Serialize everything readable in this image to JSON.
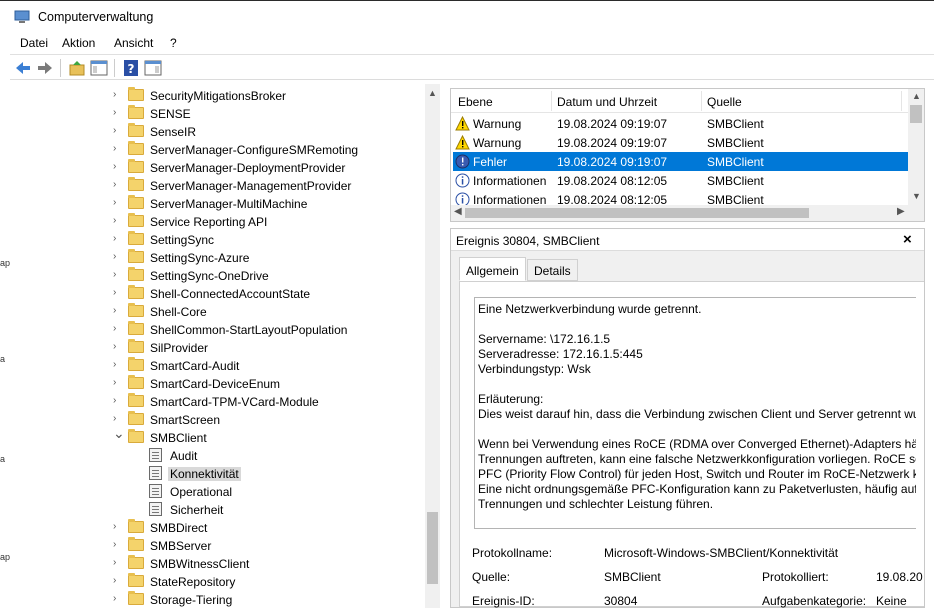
{
  "window": {
    "title": "Computerverwaltung"
  },
  "menu": {
    "items": [
      "Datei",
      "Aktion",
      "Ansicht",
      "?"
    ]
  },
  "left_edge_fragments": [
    "ap",
    "a",
    "a",
    "ap"
  ],
  "tree": {
    "items": [
      {
        "label": "SecurityMitigationsBroker",
        "type": "folder",
        "expanded": false
      },
      {
        "label": "SENSE",
        "type": "folder",
        "expanded": false
      },
      {
        "label": "SenseIR",
        "type": "folder",
        "expanded": false
      },
      {
        "label": "ServerManager-ConfigureSMRemoting",
        "type": "folder",
        "expanded": false
      },
      {
        "label": "ServerManager-DeploymentProvider",
        "type": "folder",
        "expanded": false
      },
      {
        "label": "ServerManager-ManagementProvider",
        "type": "folder",
        "expanded": false
      },
      {
        "label": "ServerManager-MultiMachine",
        "type": "folder",
        "expanded": false
      },
      {
        "label": "Service Reporting API",
        "type": "folder",
        "expanded": false
      },
      {
        "label": "SettingSync",
        "type": "folder",
        "expanded": false
      },
      {
        "label": "SettingSync-Azure",
        "type": "folder",
        "expanded": false
      },
      {
        "label": "SettingSync-OneDrive",
        "type": "folder",
        "expanded": false
      },
      {
        "label": "Shell-ConnectedAccountState",
        "type": "folder",
        "expanded": false
      },
      {
        "label": "Shell-Core",
        "type": "folder",
        "expanded": false
      },
      {
        "label": "ShellCommon-StartLayoutPopulation",
        "type": "folder",
        "expanded": false
      },
      {
        "label": "SilProvider",
        "type": "folder",
        "expanded": false
      },
      {
        "label": "SmartCard-Audit",
        "type": "folder",
        "expanded": false
      },
      {
        "label": "SmartCard-DeviceEnum",
        "type": "folder",
        "expanded": false
      },
      {
        "label": "SmartCard-TPM-VCard-Module",
        "type": "folder",
        "expanded": false
      },
      {
        "label": "SmartScreen",
        "type": "folder",
        "expanded": false
      },
      {
        "label": "SMBClient",
        "type": "folder",
        "expanded": true
      },
      {
        "label": "Audit",
        "type": "log",
        "selected": false
      },
      {
        "label": "Konnektivität",
        "type": "log",
        "selected": true
      },
      {
        "label": "Operational",
        "type": "log",
        "selected": false
      },
      {
        "label": "Sicherheit",
        "type": "log",
        "selected": false
      },
      {
        "label": "SMBDirect",
        "type": "folder",
        "expanded": false
      },
      {
        "label": "SMBServer",
        "type": "folder",
        "expanded": false
      },
      {
        "label": "SMBWitnessClient",
        "type": "folder",
        "expanded": false
      },
      {
        "label": "StateRepository",
        "type": "folder",
        "expanded": false
      },
      {
        "label": "Storage-Tiering",
        "type": "folder",
        "expanded": false
      }
    ]
  },
  "events": {
    "columns": [
      "Ebene",
      "Datum und Uhrzeit",
      "Quelle"
    ],
    "rows": [
      {
        "level": "Warnung",
        "icon": "warning-icon",
        "date": "19.08.2024 09:19:07",
        "source": "SMBClient",
        "selected": false
      },
      {
        "level": "Warnung",
        "icon": "warning-icon",
        "date": "19.08.2024 09:19:07",
        "source": "SMBClient",
        "selected": false
      },
      {
        "level": "Fehler",
        "icon": "error-icon",
        "date": "19.08.2024 09:19:07",
        "source": "SMBClient",
        "selected": true
      },
      {
        "level": "Informationen",
        "icon": "info-icon",
        "date": "19.08.2024 08:12:05",
        "source": "SMBClient",
        "selected": false
      },
      {
        "level": "Informationen",
        "icon": "info-icon",
        "date": "19.08.2024 08:12:05",
        "source": "SMBClient",
        "selected": false
      }
    ]
  },
  "detail": {
    "title": "Ereignis 30804, SMBClient",
    "close": "×",
    "tabs": [
      "Allgemein",
      "Details"
    ],
    "message_lines": [
      "Eine Netzwerkverbindung wurde getrennt.",
      "",
      "Servername: \\172.16.1.5",
      "Serveradresse: 172.16.1.5:445",
      "Verbindungstyp: Wsk",
      "",
      "Erläuterung:",
      "Dies weist darauf hin, dass die Verbindung zwischen Client und Server getrennt wur",
      "",
      "Wenn bei Verwendung eines RoCE (RDMA over Converged Ethernet)-Adapters häuf",
      "Trennungen auftreten, kann eine falsche Netzwerkkonfiguration vorliegen. RoCE se",
      "PFC (Priority Flow Control) für jeden Host, Switch und Router im RoCE-Netzwerk ko",
      "Eine nicht ordnungsgemäße PFC-Konfiguration kann zu Paketverlusten, häufig auft",
      "Trennungen und schlechter Leistung führen."
    ],
    "fields": {
      "protokollname_label": "Protokollname:",
      "protokollname_value": "Microsoft-Windows-SMBClient/Konnektivität",
      "quelle_label": "Quelle:",
      "quelle_value": "SMBClient",
      "protokolliert_label": "Protokolliert:",
      "protokolliert_value": "19.08.20",
      "ereignis_label": "Ereignis-ID:",
      "ereignis_value": "30804",
      "aufgabe_label": "Aufgabenkategorie:",
      "aufgabe_value": "Keine"
    }
  },
  "colors": {
    "selection": "#0078d7",
    "folder": "#f4d36b",
    "warning": "#ffd800",
    "error": "#3a5bb0"
  }
}
